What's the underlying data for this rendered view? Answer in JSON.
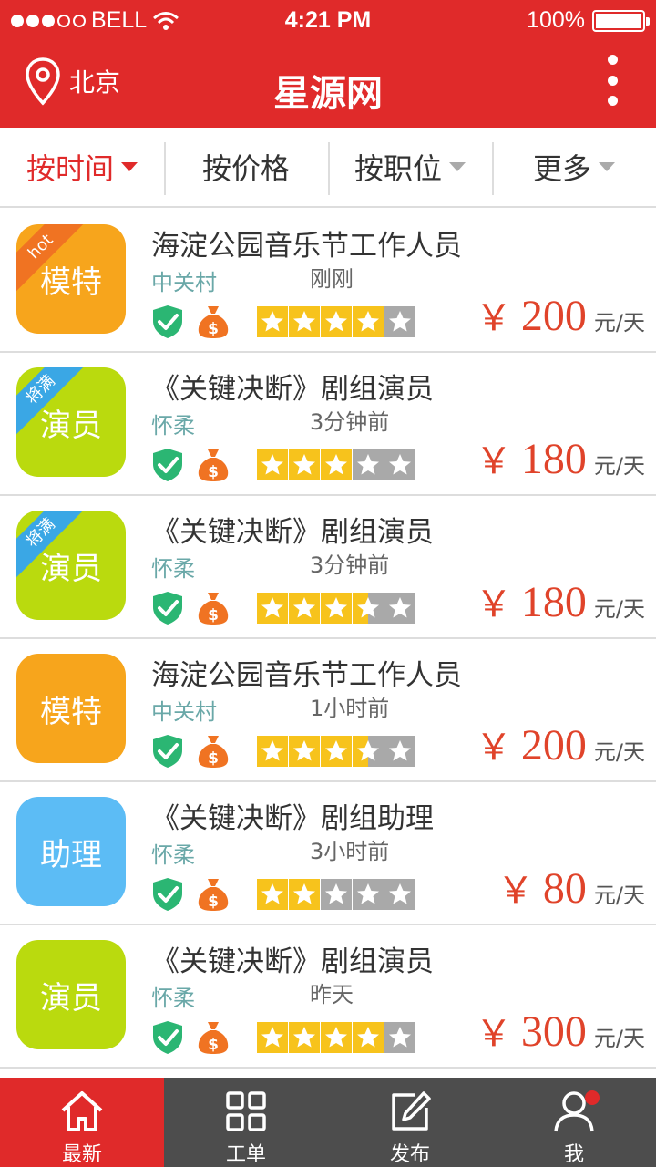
{
  "status_bar": {
    "carrier": "BELL",
    "time": "4:21 PM",
    "battery": "100%"
  },
  "header": {
    "location": "北京",
    "title": "星源网",
    "brand_color": "#e02a2a"
  },
  "filters": [
    {
      "label": "按时间",
      "active": true
    },
    {
      "label": "按价格",
      "active": false
    },
    {
      "label": "按职位",
      "active": false
    },
    {
      "label": "更多",
      "active": false
    }
  ],
  "jobs": [
    {
      "badge": "模特",
      "badge_color": "#f7a51c",
      "ribbon": "hot",
      "ribbon_color": "#f07322",
      "title": "海淀公园音乐节工作人员",
      "place": "中关村",
      "time": "刚刚",
      "rating": 4,
      "price_symbol": "￥",
      "price": "200",
      "unit": "元/天"
    },
    {
      "badge": "演员",
      "badge_color": "#bada0e",
      "ribbon": "将满",
      "ribbon_color": "#3aa7e5",
      "title": "《关键决断》剧组演员",
      "place": "怀柔",
      "time": "3分钟前",
      "rating": 3,
      "price_symbol": "￥",
      "price": "180",
      "unit": "元/天"
    },
    {
      "badge": "演员",
      "badge_color": "#bada0e",
      "ribbon": "将满",
      "ribbon_color": "#3aa7e5",
      "title": "《关键决断》剧组演员",
      "place": "怀柔",
      "time": "3分钟前",
      "rating": 3.5,
      "price_symbol": "￥",
      "price": "180",
      "unit": "元/天"
    },
    {
      "badge": "模特",
      "badge_color": "#f7a51c",
      "ribbon": "",
      "ribbon_color": "",
      "title": "海淀公园音乐节工作人员",
      "place": "中关村",
      "time": "1小时前",
      "rating": 3.5,
      "price_symbol": "￥",
      "price": "200",
      "unit": "元/天"
    },
    {
      "badge": "助理",
      "badge_color": "#5cbcf5",
      "ribbon": "",
      "ribbon_color": "",
      "title": "《关键决断》剧组助理",
      "place": "怀柔",
      "time": "3小时前",
      "rating": 2,
      "price_symbol": "￥",
      "price": "80",
      "unit": "元/天"
    },
    {
      "badge": "演员",
      "badge_color": "#bada0e",
      "ribbon": "",
      "ribbon_color": "",
      "title": "《关键决断》剧组演员",
      "place": "怀柔",
      "time": "昨天",
      "rating": 4,
      "price_symbol": "￥",
      "price": "300",
      "unit": "元/天"
    }
  ],
  "tabbar": [
    {
      "label": "最新",
      "icon": "home-icon",
      "active": true
    },
    {
      "label": "工单",
      "icon": "grid-icon",
      "active": false
    },
    {
      "label": "发布",
      "icon": "edit-icon",
      "active": false
    },
    {
      "label": "我",
      "icon": "user-icon",
      "active": false,
      "notification": true
    }
  ]
}
